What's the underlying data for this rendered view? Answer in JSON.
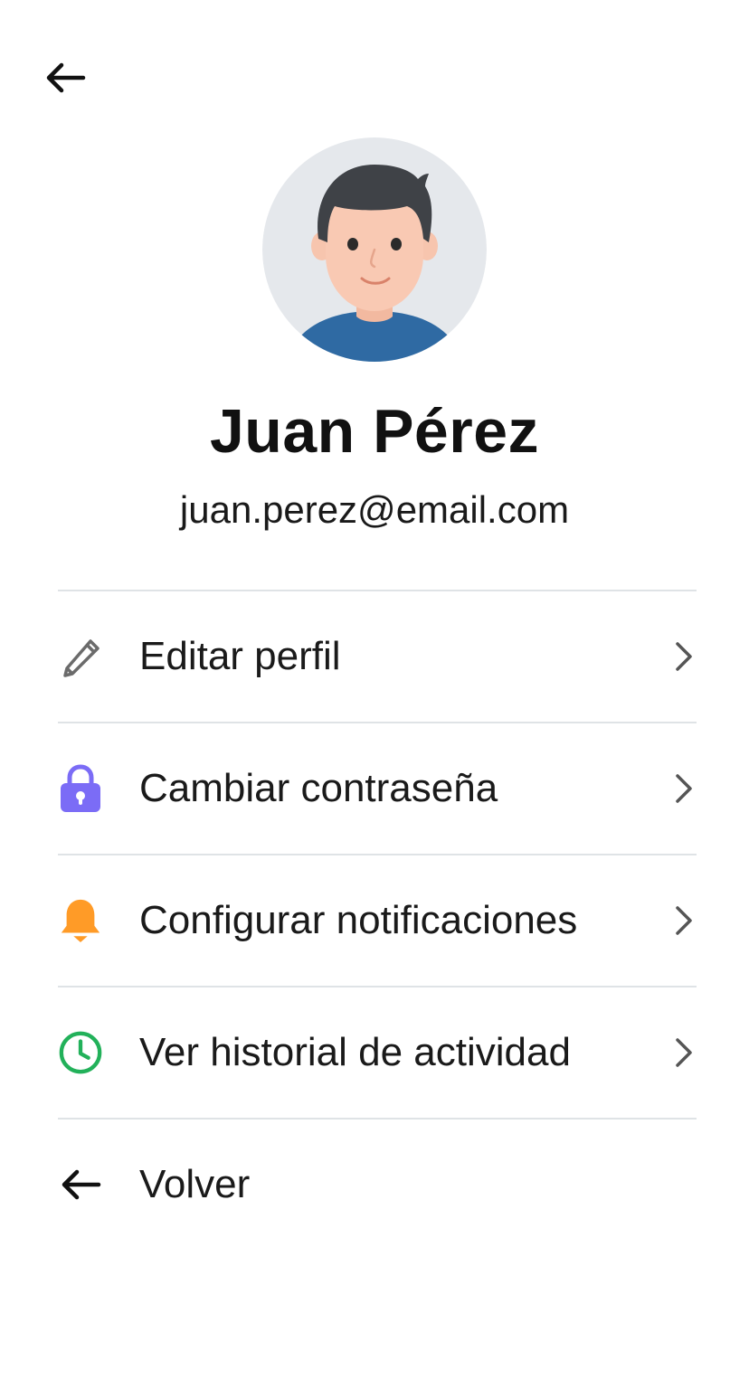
{
  "header": {
    "back_icon": "arrow-left-icon"
  },
  "profile": {
    "avatar_icon": "user-avatar",
    "name": "Juan Pérez",
    "email": "juan.perez@email.com"
  },
  "menu": {
    "items": [
      {
        "label": "Editar perfil",
        "icon": "pencil-icon",
        "icon_color": "#6b6b6b"
      },
      {
        "label": "Cambiar contraseña",
        "icon": "lock-icon",
        "icon_color": "#7b6cf6"
      },
      {
        "label": "Configurar notificaciones",
        "icon": "bell-icon",
        "icon_color": "#ff9b27"
      },
      {
        "label": "Ver historial de actividad",
        "icon": "clock-icon",
        "icon_color": "#22b15a"
      }
    ],
    "back_item": {
      "label": "Volver",
      "icon": "arrow-left-icon"
    }
  },
  "colors": {
    "divider": "#dfe3e6",
    "chevron": "#555555",
    "avatar_bg": "#e5e8ec",
    "shirt": "#2f6aa3"
  }
}
